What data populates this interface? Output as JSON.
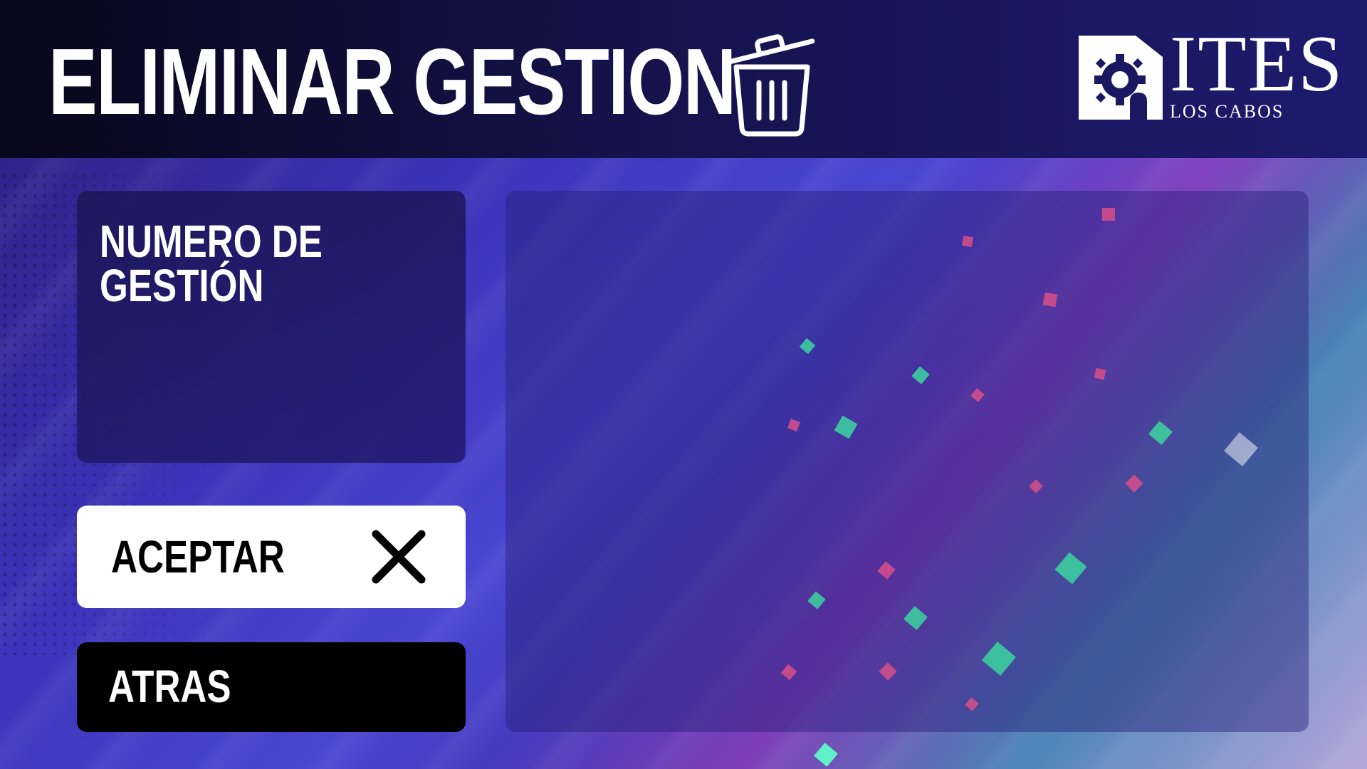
{
  "header": {
    "title": "ELIMINAR GESTION",
    "icon": "trash-icon"
  },
  "logo": {
    "name": "ITES",
    "subtitle": "LOS CABOS",
    "emblem_icon": "gear-emblem-icon"
  },
  "form": {
    "field_label": "NUMERO DE GESTIÓN"
  },
  "buttons": {
    "accept_label": "ACEPTAR",
    "accept_icon": "close-icon",
    "back_label": "ATRAS"
  },
  "colors": {
    "header_bg": "#07061a",
    "accent": "#4b46d2",
    "button_light": "#ffffff",
    "button_dark": "#000000"
  }
}
